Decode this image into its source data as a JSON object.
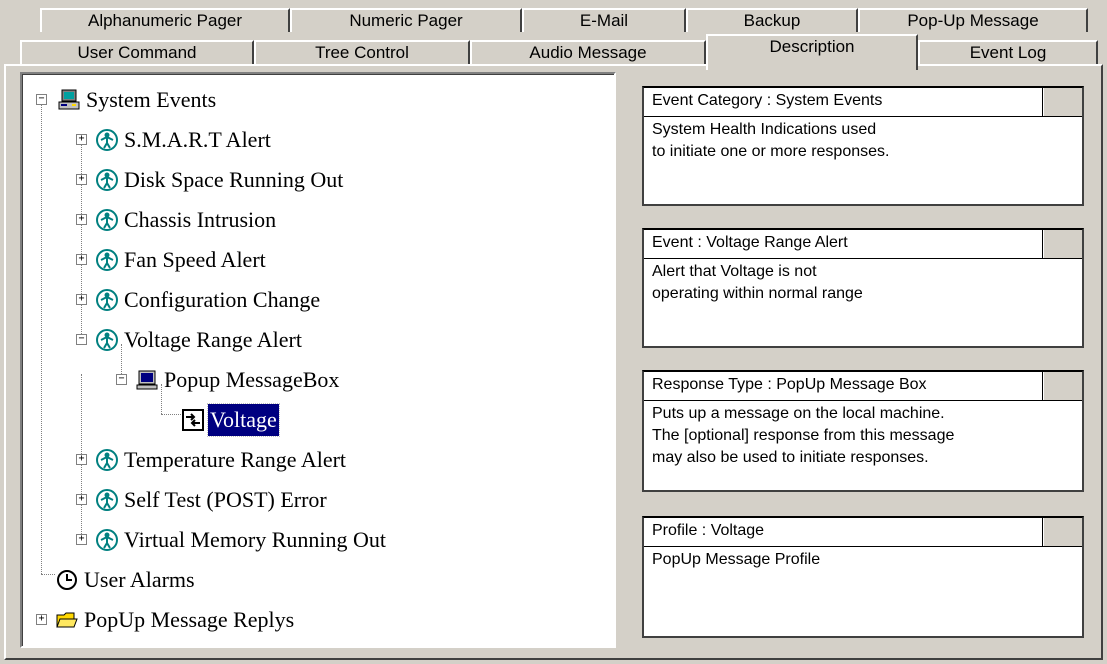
{
  "tabs_top": [
    {
      "label": "Alphanumeric Pager"
    },
    {
      "label": "Numeric Pager"
    },
    {
      "label": "E-Mail"
    },
    {
      "label": "Backup"
    },
    {
      "label": "Pop-Up Message"
    }
  ],
  "tabs_bottom": [
    {
      "label": "User Command"
    },
    {
      "label": "Tree Control"
    },
    {
      "label": "Audio Message"
    },
    {
      "label": "Description"
    },
    {
      "label": "Event Log"
    }
  ],
  "tree": {
    "root": "System Events",
    "events": [
      "S.M.A.R.T Alert",
      "Disk Space Running Out",
      "Chassis Intrusion",
      "Fan Speed Alert",
      "Configuration Change",
      "Voltage Range Alert"
    ],
    "response": "Popup MessageBox",
    "profile": "Voltage",
    "events_after": [
      "Temperature Range Alert",
      "Self Test (POST) Error",
      "Virtual Memory Running Out"
    ],
    "user_alarms": "User Alarms",
    "replys": "PopUp Message Replys"
  },
  "info_boxes": {
    "category": {
      "title": "Event Category : System Events",
      "body": "System Health Indications used\nto initiate one or more responses."
    },
    "event": {
      "title": "Event : Voltage Range Alert",
      "body": "Alert that Voltage is not\noperating within normal range"
    },
    "response": {
      "title": "Response Type :  PopUp Message Box",
      "body": "Puts up a message on the local machine.\nThe [optional] response from this message\nmay also be used to initiate responses."
    },
    "profile": {
      "title": "Profile : Voltage",
      "body": "PopUp Message Profile"
    }
  },
  "icons": {
    "root": "computer-icon",
    "event": "event-person-icon",
    "response": "monitor-icon",
    "profile": "profile-arrows-icon",
    "alarm": "clock-icon",
    "replys": "folder-icon"
  }
}
